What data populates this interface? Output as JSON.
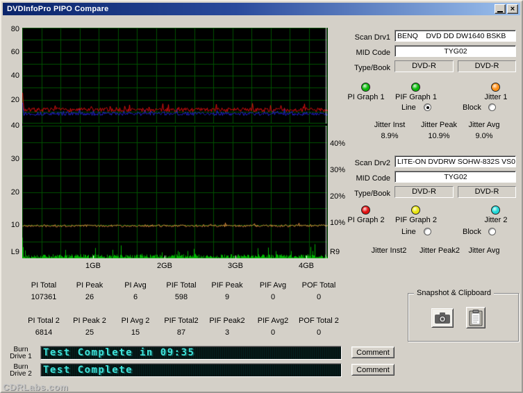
{
  "window": {
    "title": "DVDInfoPro PIPO Compare"
  },
  "titlebar": {
    "close_glyph": "×"
  },
  "drive1": {
    "scan_label": "Scan Drv1",
    "scan_value": "BENQ    DVD DD DW1640 BSKB",
    "mid_label": "MID Code",
    "mid_value": "TYG02",
    "type_label": "Type/Book",
    "type_value": "DVD-R",
    "book_value": "DVD-R",
    "pi_label": "PI Graph 1",
    "pif_label": "PIF Graph 1",
    "jitter_label": "Jitter 1",
    "pi_color": "#0cb80c",
    "pif_color": "#0cb80c",
    "jitter_color": "#ff9018",
    "line_label": "Line",
    "block_label": "Block",
    "jitter_inst_label": "Jitter Inst",
    "jitter_peak_label": "Jitter Peak",
    "jitter_avg_label": "Jitter Avg",
    "jitter_inst": "8.9%",
    "jitter_peak": "10.9%",
    "jitter_avg": "9.0%"
  },
  "drive2": {
    "scan_label": "Scan Drv2",
    "scan_value": "LITE-ON DVDRW SOHW-832S VS0",
    "mid_label": "MID Code",
    "mid_value": "TYG02",
    "type_label": "Type/Book",
    "type_value": "DVD-R",
    "book_value": "DVD-R",
    "pi_label": "PI Graph 2",
    "pif_label": "PIF Graph 2",
    "jitter_label": "Jitter 2",
    "pi_color": "#e01010",
    "pif_color": "#e8e410",
    "jitter_color": "#20d8d8",
    "line_label": "Line",
    "block_label": "Block",
    "jitter_inst_label": "Jitter Inst2",
    "jitter_peak_label": "Jitter Peak2",
    "jitter_avg_label": "Jitter Avg"
  },
  "stats_row1": [
    {
      "label": "PI Total",
      "value": "107361"
    },
    {
      "label": "PI Peak",
      "value": "26"
    },
    {
      "label": "PI Avg",
      "value": "6"
    },
    {
      "label": "PIF Total",
      "value": "598"
    },
    {
      "label": "PIF Peak",
      "value": "9"
    },
    {
      "label": "PIF Avg",
      "value": "0"
    },
    {
      "label": "POF Total",
      "value": "0"
    }
  ],
  "stats_row2": [
    {
      "label": "PI Total 2",
      "value": "6814"
    },
    {
      "label": "PI Peak 2",
      "value": "25"
    },
    {
      "label": "PI Avg 2",
      "value": "15"
    },
    {
      "label": "PIF Total2",
      "value": "87"
    },
    {
      "label": "PIF Peak2",
      "value": "3"
    },
    {
      "label": "PIF Avg2",
      "value": "0"
    },
    {
      "label": "POF Total 2",
      "value": "0"
    }
  ],
  "snapshot": {
    "group_label": "Snapshot & Clipboard"
  },
  "lcd": [
    {
      "drive_label_1": "Burn",
      "drive_label_2": "Drive 1",
      "text": "Test Complete in 09:35",
      "button": "Comment"
    },
    {
      "drive_label_1": "Burn",
      "drive_label_2": "Drive 2",
      "text": "Test Complete",
      "button": "Comment"
    }
  ],
  "watermark": "CDRLabs.com",
  "x_axis": {
    "tick_labels": [
      "1GB",
      "2GB",
      "3GB",
      "4GB"
    ]
  },
  "chart_data": [
    {
      "type": "line",
      "title": "PI errors comparison (drive1 vs drive2)",
      "ylim": [
        0,
        80
      ],
      "yticks": [
        80,
        60,
        40,
        20
      ],
      "grid": {
        "cols": 16,
        "rows": 8
      },
      "cursor_x_frac": 0.993,
      "series": [
        {
          "name": "PI Graph 2 (red)",
          "color": "#e01010",
          "baseline": 11.5,
          "noise": 1.7,
          "spike_chance": 0.07,
          "spike_max": 5,
          "start_spike": 11,
          "seed": 7
        },
        {
          "name": "PI Graph 1 (blue)",
          "color": "#2424dd",
          "baseline": 8.2,
          "noise": 1.5,
          "spike_chance": 0.05,
          "spike_max": 4,
          "start_spike": 9,
          "seed": 13
        }
      ]
    },
    {
      "type": "line",
      "title": "PIF and jitter comparison",
      "ylim": [
        0,
        40
      ],
      "yticks": [
        40,
        30,
        20,
        10
      ],
      "right_tick_labels": [
        "40%",
        "30%",
        "20%",
        "10%"
      ],
      "corner_left": "L9",
      "corner_right": "R9",
      "grid": {
        "cols": 16,
        "rows": 8
      },
      "cursor_x_frac": 0.993,
      "gb_ticks": [
        1,
        2,
        3,
        4
      ],
      "total_gb": 4.3,
      "series": [
        {
          "name": "Jitter (orange)",
          "color": "#e89040",
          "baseline": 9.8,
          "noise": 0.35,
          "spike_chance": 0.03,
          "spike_max": 0.9,
          "start_spike": 0,
          "seed": 21
        },
        {
          "name": "PIF (green)",
          "color": "#00b400",
          "baseline": 0.6,
          "noise": 0.6,
          "spike_chance": 0.07,
          "spike_max": 3.2,
          "start_spike": 6,
          "seed": 29,
          "impulse": true
        }
      ]
    }
  ]
}
